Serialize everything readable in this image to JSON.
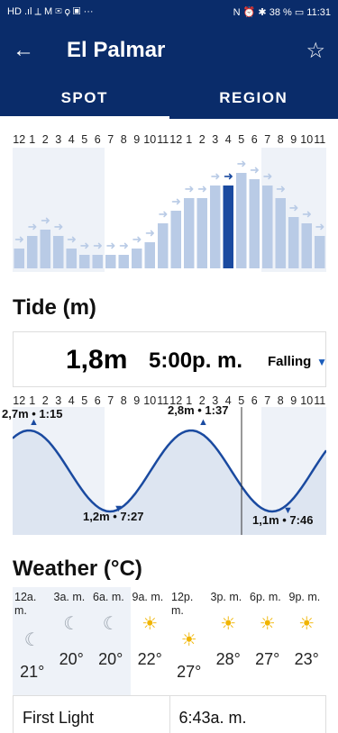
{
  "status": {
    "left": "HD  .ıl  ⟂  M  ✉  ⚲  ▣  ···",
    "right": "N ⏰ ✱ 38 % ▭ 11:31"
  },
  "header": {
    "title": "El Palmar"
  },
  "tabs": [
    {
      "label": "SPOT"
    },
    {
      "label": "REGION"
    }
  ],
  "hours": [
    "12",
    "1",
    "2",
    "3",
    "4",
    "5",
    "6",
    "7",
    "8",
    "9",
    "10",
    "11",
    "12",
    "1",
    "2",
    "3",
    "4",
    "5",
    "6",
    "7",
    "8",
    "9",
    "10",
    "11"
  ],
  "swell_chart": {
    "heights": [
      2,
      4,
      5,
      4,
      2,
      1,
      1,
      1,
      1,
      2,
      3,
      6,
      8,
      10,
      10,
      12,
      12,
      14,
      13,
      12,
      10,
      7,
      6,
      4
    ]
  },
  "tide": {
    "title": "Tide (m)",
    "height": "1,8m",
    "time": "5:00p. m.",
    "state": "Falling",
    "extremes": [
      {
        "label": "2,7m • 1:15"
      },
      {
        "label": "1,2m • 7:27"
      },
      {
        "label": "2,8m • 1:37"
      },
      {
        "label": "1,1m • 7:46"
      }
    ]
  },
  "weather": {
    "title": "Weather (°C)",
    "columns": [
      {
        "time": "12a. m.",
        "icon": "moon-icon",
        "temp": "21°"
      },
      {
        "time": "3a. m.",
        "icon": "moon-icon",
        "temp": "20°"
      },
      {
        "time": "6a. m.",
        "icon": "moon-icon",
        "temp": "20°"
      },
      {
        "time": "9a. m.",
        "icon": "sun-icon",
        "temp": "22°"
      },
      {
        "time": "12p. m.",
        "icon": "sun-icon",
        "temp": "27°"
      },
      {
        "time": "3p. m.",
        "icon": "sun-icon",
        "temp": "28°"
      },
      {
        "time": "6p. m.",
        "icon": "sun-icon",
        "temp": "27°"
      },
      {
        "time": "9p. m.",
        "icon": "sun-icon",
        "temp": "23°"
      }
    ]
  },
  "first_light": {
    "label": "First Light",
    "value": "6:43a. m."
  }
}
